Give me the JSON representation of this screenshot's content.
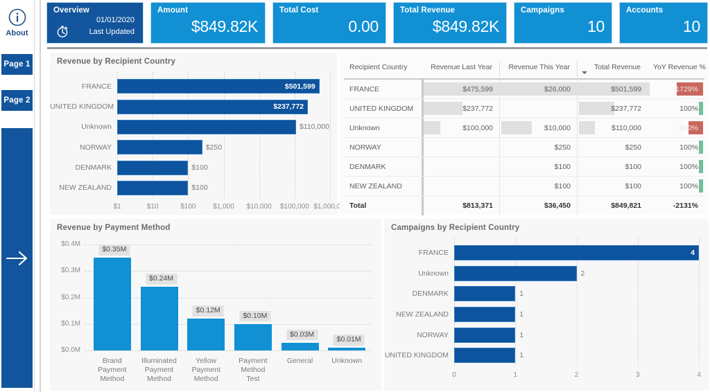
{
  "nav": {
    "about_label": "About",
    "about_icon": "info-circle-icon",
    "pages": [
      {
        "label": "Page 1"
      },
      {
        "label": "Page 2"
      }
    ],
    "expand_icon": "arrow-right-icon"
  },
  "kpis": {
    "overview": {
      "title": "Overview",
      "date": "01/01/2020",
      "updated_label": "Last Updated",
      "clock_icon": "stopwatch-icon"
    },
    "cards": [
      {
        "title": "Amount",
        "value": "$849.82K"
      },
      {
        "title": "Total Cost",
        "value": "0.00"
      },
      {
        "title": "Total Revenue",
        "value": "$849.82K"
      },
      {
        "title": "Campaigns",
        "value": "10"
      },
      {
        "title": "Accounts",
        "value": "10"
      }
    ]
  },
  "panels": {
    "revenue_by_country_title": "Revenue by Recipient Country",
    "table_title": "",
    "payment_method_title": "Revenue by Payment Method",
    "campaigns_title": "Campaigns by Recipient Country"
  },
  "table": {
    "columns": [
      "Recipient Country",
      "Revenue Last Year",
      "Revenue This Year",
      "Total Revenue",
      "YoY Revenue %"
    ],
    "sorted_column": "Total Revenue",
    "sort_icon": "sort-desc-icon",
    "rows": [
      {
        "country": "FRANCE",
        "last_year": "$475,599",
        "this_year": "$26,000",
        "total": "$501,599",
        "yoy": "-1729%",
        "ly_bar": 100,
        "ty_bar": 100,
        "tot_bar": 100,
        "yoy_sign": "neg",
        "yoy_bar": 46
      },
      {
        "country": "UNITED KINGDOM",
        "last_year": "$237,772",
        "this_year": "",
        "total": "$237,772",
        "yoy": "100%",
        "ly_bar": 50,
        "ty_bar": 0,
        "tot_bar": 50,
        "yoy_sign": "pos",
        "yoy_bar": 7
      },
      {
        "country": "Unknown",
        "last_year": "$100,000",
        "this_year": "$10,000",
        "total": "$110,000",
        "yoy": "-900%",
        "ly_bar": 21,
        "ty_bar": 39,
        "tot_bar": 23,
        "yoy_sign": "neg",
        "yoy_bar": 26
      },
      {
        "country": "NORWAY",
        "last_year": "",
        "this_year": "$250",
        "total": "$250",
        "yoy": "100%",
        "ly_bar": 0,
        "ty_bar": 0,
        "tot_bar": 0,
        "yoy_sign": "pos",
        "yoy_bar": 7
      },
      {
        "country": "DENMARK",
        "last_year": "",
        "this_year": "$100",
        "total": "$100",
        "yoy": "100%",
        "ly_bar": 0,
        "ty_bar": 0,
        "tot_bar": 0,
        "yoy_sign": "pos",
        "yoy_bar": 7
      },
      {
        "country": "NEW ZEALAND",
        "last_year": "",
        "this_year": "$100",
        "total": "$100",
        "yoy": "100%",
        "ly_bar": 0,
        "ty_bar": 0,
        "tot_bar": 0,
        "yoy_sign": "pos",
        "yoy_bar": 7
      }
    ],
    "total_row": {
      "country": "Total",
      "last_year": "$813,371",
      "this_year": "$36,450",
      "total": "$849,821",
      "yoy": "-2131%"
    }
  },
  "chart_data": [
    {
      "id": "revenue_by_recipient_country",
      "type": "bar",
      "orientation": "horizontal",
      "title": "Revenue by Recipient Country",
      "xlabel": "",
      "ylabel": "",
      "xscale": "log",
      "grid": true,
      "categories": [
        "FRANCE",
        "UNITED KINGDOM",
        "Unknown",
        "NORWAY",
        "DENMARK",
        "NEW ZEALAND"
      ],
      "values": [
        501599,
        237772,
        110000,
        250,
        100,
        100
      ],
      "data_labels": [
        "$501,599",
        "$237,772",
        "$110,000",
        "$250",
        "$100",
        "$100"
      ],
      "label_inside": [
        true,
        true,
        false,
        false,
        false,
        false
      ],
      "xticks": [
        "$1",
        "$10",
        "$100",
        "$1,000",
        "$10,000",
        "$100,000",
        "$1,000,0..."
      ],
      "bar_color": "#0e539d"
    },
    {
      "id": "revenue_by_payment_method",
      "type": "bar",
      "orientation": "vertical",
      "title": "Revenue by Payment Method",
      "xlabel": "",
      "ylabel": "",
      "grid": true,
      "categories": [
        "Brand Payment Method",
        "Illuminated Payment Method",
        "Yellow Payment Method",
        "Payment Method Test",
        "General",
        "Unknown"
      ],
      "values": [
        0.35,
        0.24,
        0.12,
        0.1,
        0.03,
        0.01
      ],
      "data_labels": [
        "$0.35M",
        "$0.24M",
        "$0.12M",
        "$0.10M",
        "$0.03M",
        "$0.01M"
      ],
      "yticks": [
        "$0.0M",
        "$0.1M",
        "$0.2M",
        "$0.3M",
        "$0.4M"
      ],
      "ylim": [
        0,
        0.4
      ],
      "bar_color": "#1190d4"
    },
    {
      "id": "campaigns_by_recipient_country",
      "type": "bar",
      "orientation": "horizontal",
      "title": "Campaigns by Recipient Country",
      "xlabel": "",
      "ylabel": "",
      "grid": true,
      "categories": [
        "FRANCE",
        "Unknown",
        "DENMARK",
        "NEW ZEALAND",
        "NORWAY",
        "UNITED KINGDOM"
      ],
      "values": [
        4,
        2,
        1,
        1,
        1,
        1
      ],
      "data_labels": [
        "4",
        "2",
        "1",
        "1",
        "1",
        "1"
      ],
      "label_inside": [
        true,
        false,
        false,
        false,
        false,
        false
      ],
      "xticks": [
        "0",
        "1",
        "2",
        "3",
        "4"
      ],
      "xlim": [
        0,
        4
      ],
      "bar_color": "#0e539d"
    }
  ],
  "colors": {
    "accent_light_blue": "#1190d4",
    "accent_dark_blue": "#12559c",
    "panel_bg": "#f7f7f7",
    "negative_red": "#c9675e",
    "positive_green": "#72bf9a",
    "databar_gray": "#e0e0e0"
  }
}
